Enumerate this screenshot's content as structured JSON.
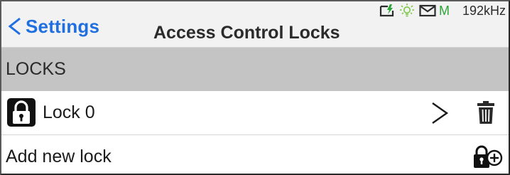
{
  "header": {
    "back_label": "Settings",
    "title": "Access Control Locks"
  },
  "status_bar": {
    "icons": [
      "charging-icon",
      "light-bulb-icon",
      "mail-icon"
    ],
    "m_label": "M",
    "frequency": "192kHz"
  },
  "section": {
    "label": "LOCKS"
  },
  "locks": [
    {
      "label": "Lock 0"
    }
  ],
  "add_lock": {
    "label": "Add new lock"
  },
  "colors": {
    "accent": "#1f6fe0",
    "status_green": "#2aa535",
    "section_bg": "#c4c4c4"
  }
}
